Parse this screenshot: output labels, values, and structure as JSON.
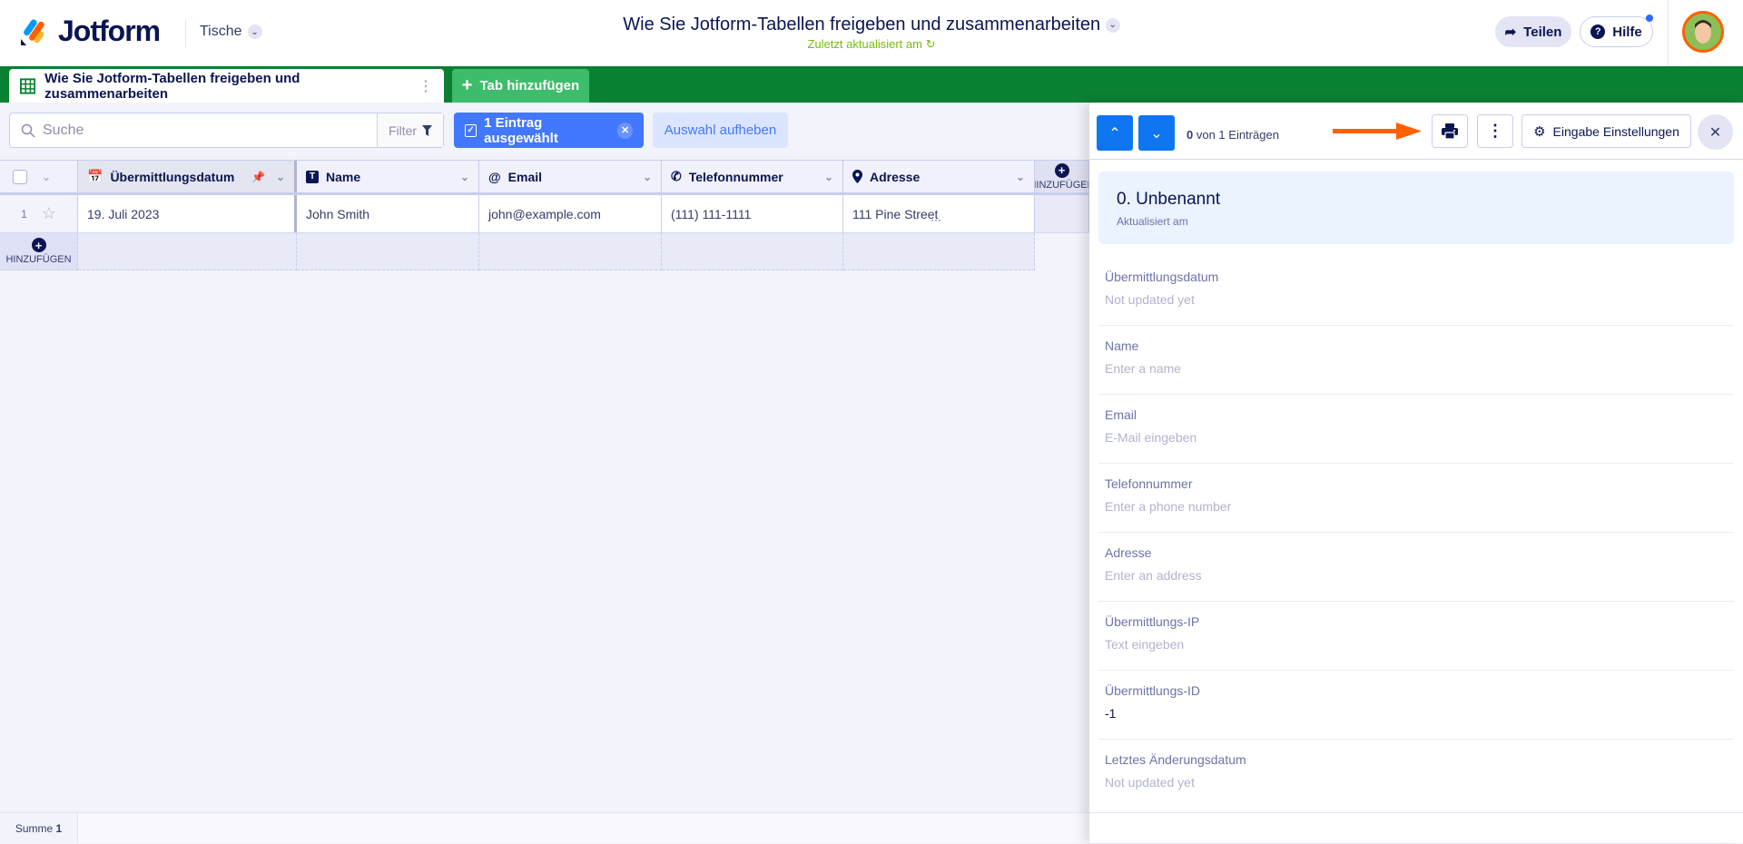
{
  "header": {
    "logo": "Jotform",
    "workspace": "Tische",
    "title": "Wie Sie Jotform-Tabellen freigeben und zusammenarbeiten",
    "subtitle": "Zuletzt aktualisiert am",
    "share_label": "Teilen",
    "help_label": "Hilfe"
  },
  "tabs": {
    "active": "Wie Sie Jotform-Tabellen freigeben und zusammenarbeiten",
    "add": "Tab hinzufügen"
  },
  "toolbar": {
    "search_placeholder": "Suche",
    "filter_label": "Filter",
    "selected_label": "1 Eintrag ausgewählt",
    "deselect_label": "Auswahl aufheben"
  },
  "table": {
    "columns": [
      "Übermittlungsdatum",
      "Name",
      "Email",
      "Telefonnummer",
      "Adresse"
    ],
    "add_column": "HINZUFÜGEN",
    "rows": [
      {
        "index": "1",
        "cells": [
          "19. Juli 2023",
          "John Smith",
          "john@example.com",
          "(111) 111-1111",
          "111 Pine Street"
        ]
      }
    ],
    "add_row": "HINZUFÜGEN",
    "footer": {
      "label": "Summe",
      "count": "1"
    }
  },
  "panel": {
    "count_text": "von 1 Einträgen",
    "count_value": "0",
    "settings_label": "Eingabe Einstellungen",
    "record_title": "0. Unbenannt",
    "record_sub": "Aktualisiert am",
    "fields": [
      {
        "label": "Übermittlungsdatum",
        "value": "Not updated yet"
      },
      {
        "label": "Name",
        "value": "Enter a name"
      },
      {
        "label": "Email",
        "value": "E-Mail eingeben"
      },
      {
        "label": "Telefonnummer",
        "value": "Enter a phone number"
      },
      {
        "label": "Adresse",
        "value": "Enter an address"
      },
      {
        "label": "Übermittlungs-IP",
        "value": "Text eingeben"
      },
      {
        "label": "Übermittlungs-ID",
        "value": "-1"
      },
      {
        "label": "Letztes Änderungsdatum",
        "value": "Not updated yet"
      }
    ]
  },
  "colors": {
    "brand_green": "#0a8033",
    "accent_blue": "#4277ff",
    "arrow": "#ff6100"
  }
}
